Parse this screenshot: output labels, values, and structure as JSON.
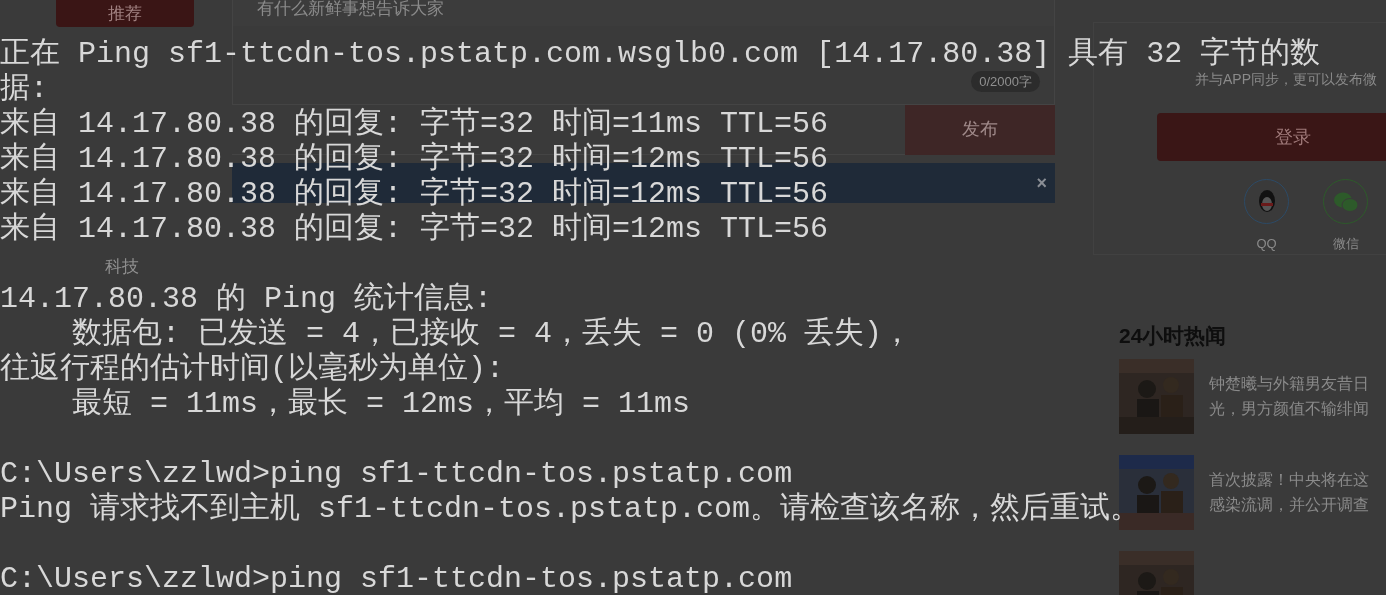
{
  "web_page": {
    "sidebar": {
      "items": [
        {
          "label": "推荐",
          "selected": true
        },
        {
          "label": "科技",
          "selected": false
        }
      ]
    },
    "composer": {
      "placeholder": "有什么新鲜事想告诉大家",
      "counter": "0/2000字",
      "submit": "发布"
    },
    "notice": {
      "close": "×"
    },
    "login_card": {
      "prompt": "并与APP同步，更可以发布微",
      "button": "登录",
      "providers": [
        "QQ",
        "微信"
      ]
    },
    "hot_news": {
      "title": "24小时热闻",
      "items": [
        {
          "kind": "headline",
          "lines": [
            "钟楚曦与外籍男友昔日",
            "光，男方颜值不输绯闻"
          ]
        },
        {
          "kind": "headline",
          "lines": [
            "首次披露！中央将在这",
            "感染流调，并公开调查"
          ]
        },
        {
          "kind": "picture"
        }
      ]
    }
  },
  "console": {
    "blocks": [
      [
        "正在 Ping sf1-ttcdn-tos.pstatp.com.wsglb0.com [14.17.80.38] 具有 32 字节的数",
        "据:",
        "来自 14.17.80.38 的回复: 字节=32 时间=11ms TTL=56",
        "来自 14.17.80.38 的回复: 字节=32 时间=12ms TTL=56",
        "来自 14.17.80.38 的回复: 字节=32 时间=12ms TTL=56",
        "来自 14.17.80.38 的回复: 字节=32 时间=12ms TTL=56"
      ],
      [
        "14.17.80.38 的 Ping 统计信息:",
        "    数据包: 已发送 = 4，已接收 = 4，丢失 = 0 (0% 丢失)，",
        "往返行程的估计时间(以毫秒为单位):",
        "    最短 = 11ms，最长 = 12ms，平均 = 11ms"
      ],
      [
        "C:\\Users\\zzlwd>ping sf1-ttcdn-tos.pstatp.com",
        "Ping 请求找不到主机 sf1-ttcdn-tos.pstatp.com。请检查该名称，然后重试。"
      ],
      [
        "C:\\Users\\zzlwd>ping sf1-ttcdn-tos.pstatp.com"
      ]
    ]
  }
}
